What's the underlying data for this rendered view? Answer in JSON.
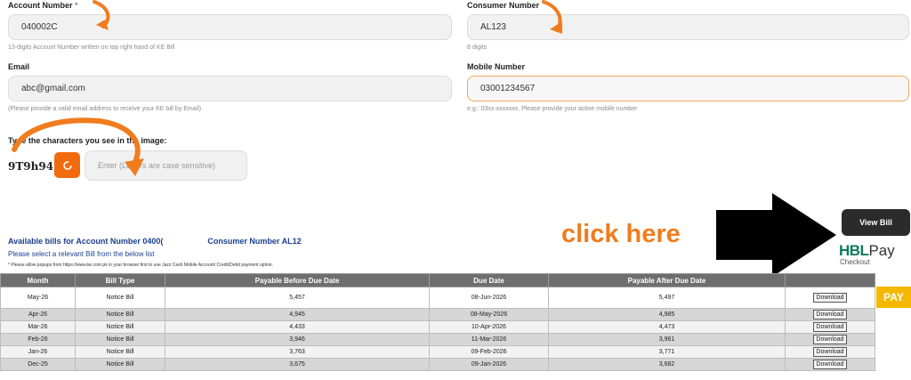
{
  "form": {
    "account": {
      "label": "Account Number",
      "required_mark": "*",
      "value": "040002C",
      "hint": "13-digits Account Number written on top right hand of KE Bill"
    },
    "consumer": {
      "label": "Consumer Number",
      "value": "AL123",
      "hint": "8 digits"
    },
    "email": {
      "label": "Email",
      "value": "abc@gmail.com",
      "hint": "(Please provide a valid email address to receive your KE bill by Email)"
    },
    "mobile": {
      "label": "Mobile Number",
      "value": "03001234567",
      "hint": "e.g.: 03xx-xxxxxxx. Please provide your active mobile number"
    },
    "captcha": {
      "label": "Type the characters you see in the image:",
      "code": "9T9h947",
      "placeholder": "Enter (Letters are case sensitive)"
    }
  },
  "actions": {
    "view_bill": "View Bill",
    "annotation": "click here",
    "pay": "PAY"
  },
  "hbl": {
    "brand": "HBL",
    "pay": "Pay",
    "sub": "Checkout"
  },
  "bills": {
    "heading_prefix": "Available bills for Account Number 0400(",
    "heading_consumer": "Consumer Number AL12",
    "subheading": "Please select a relevant Bill from the below list",
    "note": "* Please allow popups from https://www.ke.com.pk in your browser first to use Jazz Cash Mobile Account/ Credit/Debit payment option.",
    "columns": [
      "Month",
      "Bill Type",
      "Payable Before Due Date",
      "Due Date",
      "Payable After Due Date",
      ""
    ],
    "download_label": "Download",
    "rows": [
      {
        "month": "May-26",
        "type": "Notice Bill",
        "before": "5,457",
        "due": "08-Jun-2026",
        "after": "5,497"
      },
      {
        "month": "Apr-26",
        "type": "Notice Bill",
        "before": "4,945",
        "due": "08-May-2026",
        "after": "4,985"
      },
      {
        "month": "Mar-26",
        "type": "Notice Bill",
        "before": "4,433",
        "due": "10-Apr-2026",
        "after": "4,473"
      },
      {
        "month": "Feb-26",
        "type": "Notice Bill",
        "before": "3,946",
        "due": "11-Mar-2026",
        "after": "3,961"
      },
      {
        "month": "Jan-26",
        "type": "Notice Bill",
        "before": "3,763",
        "due": "09-Feb-2026",
        "after": "3,771"
      },
      {
        "month": "Dec-25",
        "type": "Notice Bill",
        "before": "3,675",
        "due": "09-Jan-2026",
        "after": "3,682"
      }
    ]
  },
  "colors": {
    "annotation": "#f07c1e",
    "pay_button": "#f5b800",
    "captcha_button": "#f26a0e",
    "heading_blue": "#1b3f8f",
    "hbl_green": "#0b7a5c"
  }
}
